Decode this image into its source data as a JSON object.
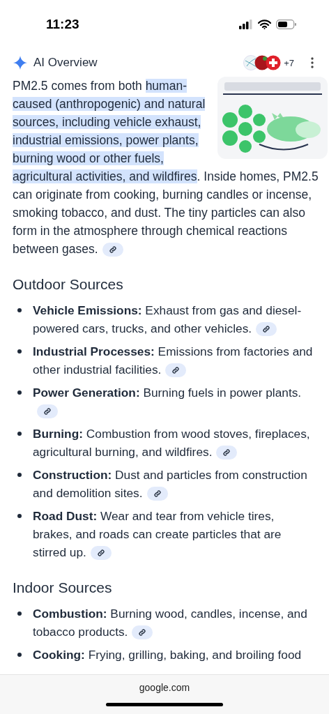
{
  "status_bar": {
    "time": "11:23"
  },
  "header": {
    "title": "AI Overview",
    "source_count": "+7"
  },
  "intro": {
    "segments": [
      {
        "text": "PM2.5 comes from both ",
        "highlighted": false
      },
      {
        "text": "human-caused (anthropogenic) and natural sources, including vehicle exhaust, industrial emissions, power plants, burning wood or other fuels, agricultural activities, and wildfires",
        "highlighted": true
      },
      {
        "text": ". Inside homes, PM2.5 can originate from cooking, burning candles or incense, smoking tobacco, and dust. The tiny particles can also form in the atmosphere through chemical reactions between gases.",
        "highlighted": false
      }
    ],
    "has_link": true
  },
  "sections": [
    {
      "heading": "Outdoor Sources",
      "items": [
        {
          "text": "**Vehicle Emissions:** Exhaust from gas and diesel-powered cars, trucks, and other vehicles.",
          "has_link": true
        },
        {
          "text": "**Industrial Processes:** Emissions from factories and other industrial facilities.",
          "has_link": true
        },
        {
          "text": "**Power Generation:** Burning fuels in power plants.",
          "has_link": true
        },
        {
          "text": "**Burning:** Combustion from wood stoves, fireplaces, agricultural burning, and wildfires.",
          "has_link": true
        },
        {
          "text": "**Construction:** Dust and particles from construction and demolition sites.",
          "has_link": true
        },
        {
          "text": "**Road Dust:** Wear and tear from vehicle tires, brakes, and roads can create particles that are stirred up.",
          "has_link": true
        }
      ]
    },
    {
      "heading": "Indoor Sources",
      "items": [
        {
          "text": "**Combustion:** Burning wood, candles, incense, and tobacco products.",
          "has_link": true
        },
        {
          "text": "**Cooking:** Frying, grilling, baking, and broiling food",
          "has_link": false
        }
      ]
    }
  ],
  "browser_bar": {
    "url": "google.com"
  }
}
